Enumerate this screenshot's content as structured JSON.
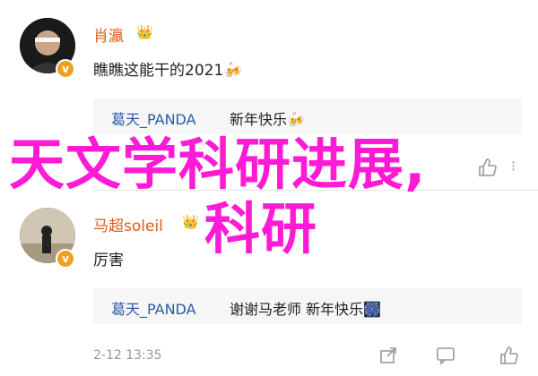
{
  "comments": [
    {
      "username": "肖瀛",
      "badge_icon": "crown-badge-icon",
      "text": "瞧瞧这能干的2021🍻",
      "reply": {
        "name": "葛天_PANDA",
        "text": "新年快乐🍻"
      }
    },
    {
      "username": "马超soleil",
      "badge_icon": "crown-badge-icon",
      "text": "厉害",
      "reply": {
        "name": "葛天_PANDA",
        "text": "谢谢马老师 新年快乐🎆"
      },
      "timestamp": "2-12 13:35"
    }
  ],
  "verify_mark": "v",
  "overlay": {
    "line1": "天文学科研进展,",
    "line2": "科研"
  },
  "colors": {
    "username": "#e05a1a",
    "reply_name": "#2b5aa8",
    "overlay": "#ff1ad6"
  }
}
